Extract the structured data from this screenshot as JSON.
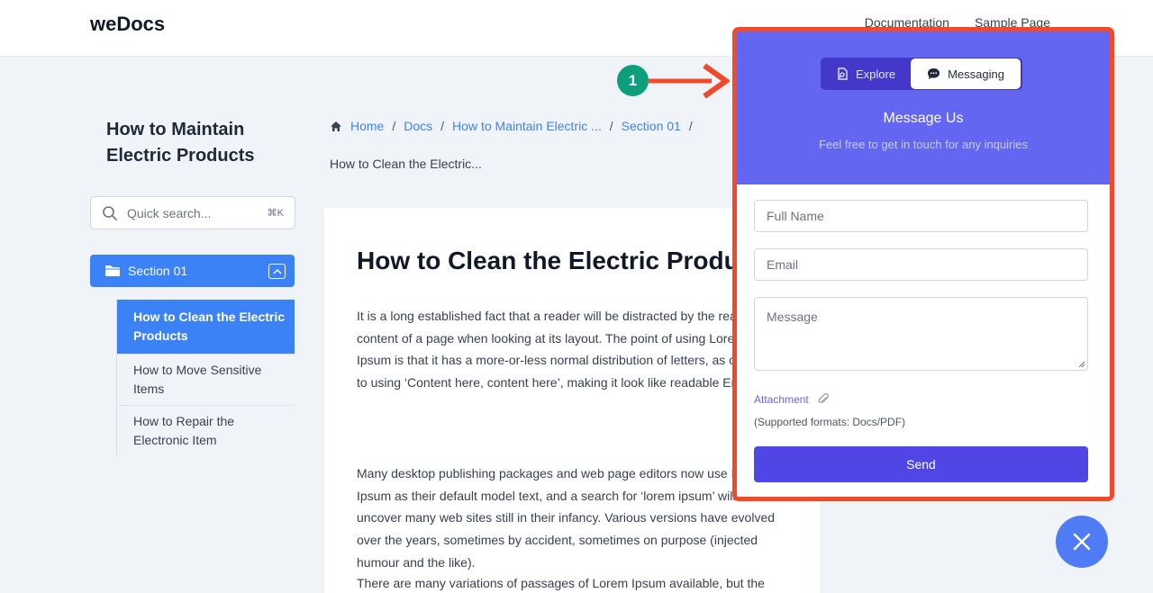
{
  "header": {
    "brand": "weDocs",
    "nav": [
      "Documentation",
      "Sample Page"
    ]
  },
  "sidebar": {
    "doc_title": "How to Maintain Electric Products",
    "search": {
      "placeholder": "Quick search...",
      "shortcut": "⌘K"
    },
    "section": {
      "label": "Section 01"
    },
    "items": [
      {
        "label": "How to Clean the Electric Products",
        "active": true
      },
      {
        "label": "How to Move Sensitive Items",
        "active": false
      },
      {
        "label": "How to Repair the Electronic Item",
        "active": false
      }
    ]
  },
  "breadcrumb": {
    "items": [
      "Home",
      "Docs",
      "How to Maintain Electric ...",
      "Section 01"
    ],
    "current": "How to Clean the Electric..."
  },
  "article": {
    "title": "How to Clean the Electric Products",
    "paragraphs": [
      "It is a long established fact that a reader will be distracted by the readable content of a page when looking at its layout. The point of using Lorem Ipsum is that it has a more-or-less normal distribution of letters, as opposed to using ‘Content here, content here’, making it look like readable English.",
      "Many desktop publishing packages and web page editors now use Lorem Ipsum as their default model text, and a search for ‘lorem ipsum’ will uncover many web sites still in their infancy. Various versions have evolved over the years, sometimes by accident, sometimes on purpose (injected humour and the like).",
      "There are many variations of passages of Lorem Ipsum available, but the"
    ]
  },
  "annotation": {
    "step": "1",
    "color": "#f04a2a",
    "badge_color": "#0d9e7d"
  },
  "chat_panel": {
    "tabs": [
      {
        "label": "Explore",
        "icon": "explore-icon",
        "selected": false
      },
      {
        "label": "Messaging",
        "icon": "chat-bubble-icon",
        "selected": true
      }
    ],
    "title": "Message Us",
    "subtitle": "Feel free to get in touch for any inquiries",
    "fields": {
      "full_name": {
        "placeholder": "Full Name",
        "value": ""
      },
      "email": {
        "placeholder": "Email",
        "value": ""
      },
      "message": {
        "placeholder": "Message",
        "value": ""
      }
    },
    "attachment_label": "Attachment",
    "formats_note": "(Supported formats: Docs/PDF)",
    "send_label": "Send",
    "accent": "#6366f1",
    "button_color": "#4f46e5"
  },
  "colors": {
    "primary": "#3b82f6",
    "background": "#f0f4f9"
  }
}
